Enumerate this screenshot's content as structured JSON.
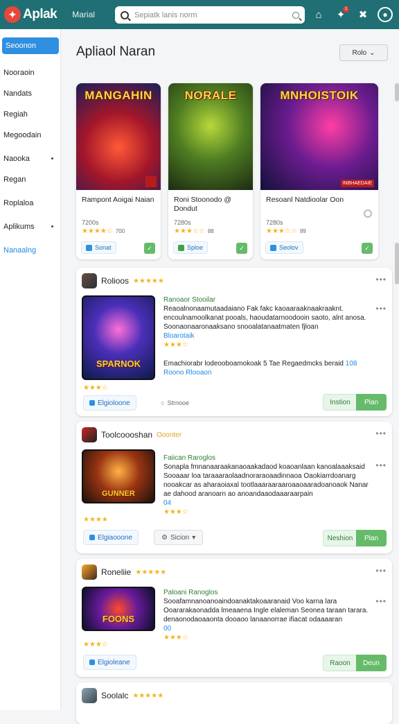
{
  "topbar": {
    "logo_text": "Aplak",
    "nav_label": "Marial",
    "search_placeholder": "Sepiatk lanis norm",
    "icons": [
      "home-icon",
      "notifications-icon",
      "tools-icon",
      "account-icon"
    ],
    "badge_count": "1"
  },
  "sidebar": {
    "active": "Seoonon",
    "items": [
      {
        "label": "Nooraoin",
        "dot": false
      },
      {
        "label": "Nandats",
        "dot": false
      },
      {
        "label": "Regiah",
        "dot": false
      },
      {
        "label": "Megoodain",
        "dot": false
      },
      {
        "label": "Naooka",
        "dot": true
      },
      {
        "label": "Regan",
        "dot": false
      },
      {
        "label": "Roplaloa",
        "dot": false
      },
      {
        "label": "Aplikums",
        "dot": true
      },
      {
        "label": "Nanaalng",
        "dot": false,
        "highlight": true
      }
    ]
  },
  "main": {
    "title": "Apliaol Naran",
    "sort_label": "Rolo"
  },
  "featured": [
    {
      "art_title": "MANGAHIN",
      "name": "Rampont Aoigai Naian",
      "sub": "7200s",
      "rating_count": "700",
      "chip": "Sonat",
      "chip_color": "#2f8fe0",
      "art_bg": "radial-gradient(circle at 50% 60%, #ff5a36 0%, #a3162a 45%, #1a1f5a 100%)",
      "corner": ""
    },
    {
      "art_title": "NORALE",
      "name": "Roni Stoonodo @ Dondut",
      "sub": "7280s",
      "rating_count": "88",
      "chip": "Sploe",
      "chip_color": "#43a047",
      "art_bg": "radial-gradient(circle at 50% 40%, #b7d93a 0%, #4e7d22 45%, #1d2b12 100%)",
      "corner": ""
    },
    {
      "art_title": "MNHOISTOIK",
      "name": "Resoanl Natdioolar Oon",
      "sub": "7280s",
      "rating_count": "99",
      "chip": "Seolov",
      "chip_color": "#2f8fe0",
      "art_bg": "radial-gradient(circle at 60% 40%, #ff3ea5 0%, #6b1c8f 45%, #12103a 100%)",
      "corner": "INBHAEDAIE"
    }
  ],
  "posts": [
    {
      "name": "Rolioos",
      "tag": "Ranoaor Stooilar",
      "text": "Reaoalnonaamutaadaiano Fak fakc kaoaaraaknaakraaknt. encoulnamoolkanat pooals, haoudatarnoodooin saoto, alnt anosa. Soonaonaaronaaksano snooalatanaatmaten fjloan",
      "link": "Bloarotaik",
      "art_title": "SPARNOK",
      "art_bg": "radial-gradient(circle at 50% 40%, #ff6fd8 0%, #4b2fb8 40%, #0d1b4a 100%)",
      "line2": "Emachiorabr lodeooboamokoak 5 Tae Regaedmcks beraid",
      "line2_link": "108",
      "line3": "Roono Rlooaon",
      "chip": "Elgioloone",
      "mid": "Strnooe",
      "install": "Instion",
      "play": "Plan"
    },
    {
      "name": "Toolcoooshan",
      "tag": "Faiican Raroglos",
      "text": "Sonapla fmnanaaraakanaoaakadaod koaoanlaan kanoalaaaksaid Sooaaar loa taraaaraolaadnoraraoaadinnaoa Oaokiarrdoanarg nooakcar as aharaoiaxal tootlaaaraaraaroaaoaaradoanoaok Nanar ae dahood aranoarn ao anoandaaodaaaraarpain",
      "link": "04",
      "art_title": "GUNNER",
      "art_bg": "radial-gradient(circle at 50% 40%, #ffb347 0%, #9a3412 45%, #1c120b 100%)",
      "chip": "Elgiaooone",
      "mid": "Sicion",
      "install": "Neshion",
      "play": "Plan",
      "head_sub": "Ooonter"
    },
    {
      "name": "Roneliie",
      "tag": "Paloani Ranoglos",
      "text": "Sooafamnanoanoaindoanaktakoaaranaid Voo karna lara Ooararakaonadda lmeaaena Ingle elaleman Seonea taraan tarara. denaonodaoaaonta dooaoo lanaanorrae ifiacat odaaaaran",
      "link": "00",
      "art_title": "FOONS",
      "art_bg": "radial-gradient(circle at 50% 50%, #ff4b2b 0%, #6a1b9a 45%, #0c0f2e 100%)",
      "chip": "Elgioleane",
      "install": "Raoon",
      "play": "Deun"
    },
    {
      "name": "Soolalc"
    }
  ]
}
